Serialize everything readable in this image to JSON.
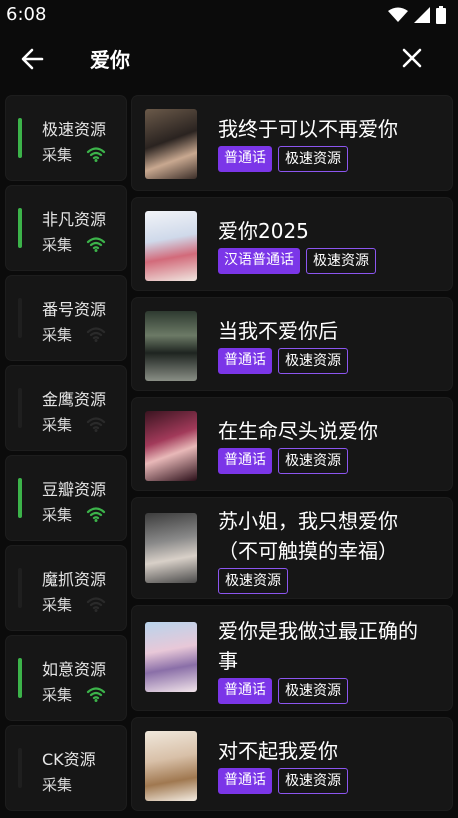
{
  "status": {
    "time": "6:08"
  },
  "header": {
    "title": "爱你"
  },
  "sources": [
    {
      "name": "极速资源",
      "sub": "采集",
      "active": true
    },
    {
      "name": "非凡资源",
      "sub": "采集",
      "active": true
    },
    {
      "name": "番号资源",
      "sub": "采集",
      "active": false
    },
    {
      "name": "金鹰资源",
      "sub": "采集",
      "active": false
    },
    {
      "name": "豆瓣资源",
      "sub": "采集",
      "active": true
    },
    {
      "name": "魔抓资源",
      "sub": "采集",
      "active": false
    },
    {
      "name": "如意资源",
      "sub": "采集",
      "active": true
    },
    {
      "name": "CK资源",
      "sub": "采集",
      "active": false
    }
  ],
  "results": [
    {
      "title": "我终于可以不再爱你",
      "tags": [
        "普通话",
        "极速资源"
      ]
    },
    {
      "title": "爱你2025",
      "tags": [
        "汉语普通话",
        "极速资源"
      ]
    },
    {
      "title": "当我不爱你后",
      "tags": [
        "普通话",
        "极速资源"
      ]
    },
    {
      "title": "在生命尽头说爱你",
      "tags": [
        "普通话",
        "极速资源"
      ]
    },
    {
      "title_line1": "苏小姐，我只想爱你",
      "title_line2": "（不可触摸的幸福）",
      "tags": [
        "极速资源"
      ]
    },
    {
      "title_line1": "爱你是我做过最正确的",
      "title_line2": "事",
      "tags": [
        "普通话",
        "极速资源"
      ]
    },
    {
      "title": "对不起我爱你",
      "tags": [
        "普通话",
        "极速资源"
      ]
    }
  ],
  "colors": {
    "active_green": "#3cb34a",
    "inactive_gray": "#2a2a2a",
    "tag_purple": "#7b36e8"
  }
}
